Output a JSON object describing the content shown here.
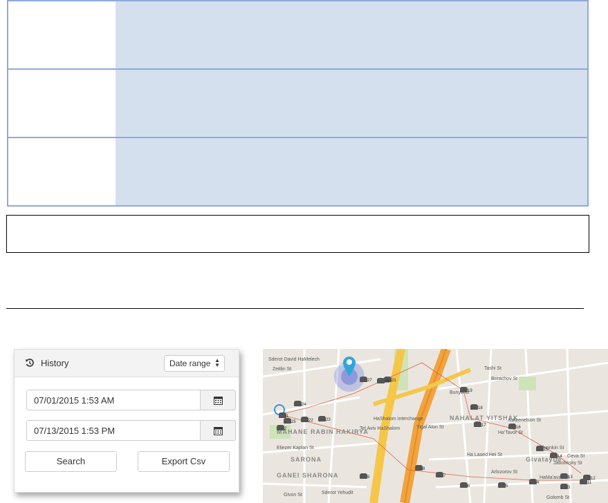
{
  "history": {
    "title": "History",
    "range_select": "Date range",
    "from_date": "07/01/2015 1:53 AM",
    "to_date": "07/13/2015 1:53 PM",
    "search_label": "Search",
    "export_label": "Export Csv"
  },
  "map": {
    "labels": {
      "zeitlin": "Zeitlin St",
      "sderot_david": "Sderot David HaMelech",
      "tashi": "Tashi St",
      "borachov": "Borachov St",
      "bunya": "Bunya St",
      "nahalat_yitshak": "NAHALAT YITSHAK",
      "katzenelson": "Katzenelson St",
      "hatavor": "Ha'Tavor St",
      "sheinkin": "Sheinkin St",
      "geva": "Geva St",
      "jabotinsky": "Jabotinsky St",
      "halesed": "Ha Lased Hei St",
      "givatayim": "Givatayim",
      "hamaavak": "HaMa'avak St",
      "mahane": "MAHANE RABIN HAKIRYA",
      "eliezer": "Eliezer Kaplan St",
      "sarona": "SARONA",
      "ganei": "GANEI SHARONA",
      "tel_aviv": "Tel Aviv HaShalom",
      "hashalom": "HaShalom Interchange",
      "givon": "Givon St",
      "sderot_yehudit": "Sderot Yehudit",
      "golomb": "Golomb St",
      "yigal_alon": "Yigal Alon St",
      "arlozorov": "Arlozorov St"
    },
    "markers": [
      "21",
      "19",
      "18",
      "17",
      "16",
      "15",
      "14",
      "13",
      "12",
      "11",
      "24",
      "23",
      "22",
      "27",
      "26",
      "25",
      "9",
      "8",
      "7",
      "6",
      "5",
      "4",
      "3",
      "2",
      "1"
    ]
  }
}
